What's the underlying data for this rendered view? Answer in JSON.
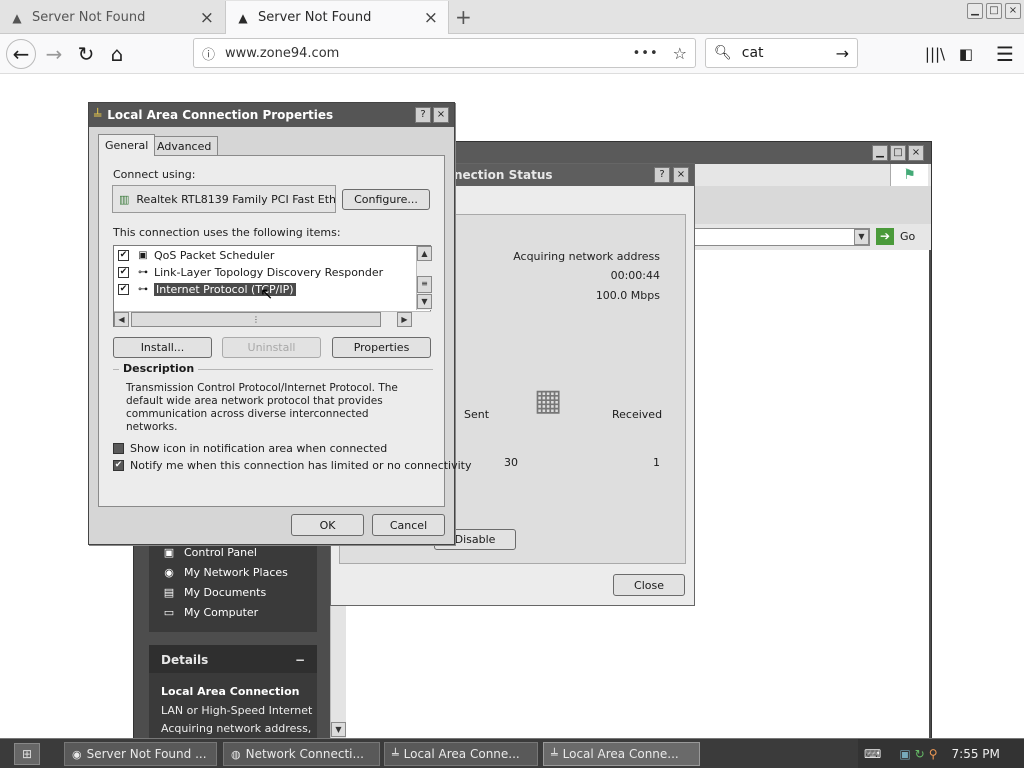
{
  "browser": {
    "tabs": [
      {
        "title": "Server Not Found",
        "icon": "warning-icon",
        "active": false
      },
      {
        "title": "Server Not Found",
        "icon": "warning-icon",
        "active": true
      }
    ],
    "new_tab_glyph": "+",
    "url": "www.zone94.com",
    "search_query": "cat",
    "nav_icons": [
      "back-icon",
      "forward-icon",
      "reload-icon",
      "home-icon"
    ],
    "toolbar_icons": [
      "library-icon",
      "sidebar-icon",
      "menu-icon"
    ]
  },
  "network_connections_window": {
    "go_label": "Go",
    "other_places": [
      {
        "label": "Control Panel",
        "icon": "control-panel-icon"
      },
      {
        "label": "My Network Places",
        "icon": "network-places-icon"
      },
      {
        "label": "My Documents",
        "icon": "documents-icon"
      },
      {
        "label": "My Computer",
        "icon": "computer-icon"
      }
    ],
    "details": {
      "heading": "Details",
      "name": "Local Area Connection",
      "line1": "LAN or High-Speed Internet",
      "line2": "Acquiring network address,"
    }
  },
  "status_dialog": {
    "title": "nection Status",
    "status_value": "Acquiring network address",
    "duration_value": "00:00:44",
    "speed_value": "100.0 Mbps",
    "sent_label": "Sent",
    "received_label": "Received",
    "sent_value": "30",
    "received_value": "1",
    "disable_label": "Disable",
    "close_label": "Close"
  },
  "properties_dialog": {
    "title": "Local Area Connection Properties",
    "tabs": [
      "General",
      "Advanced"
    ],
    "connect_using_label": "Connect using:",
    "adapter_name": "Realtek RTL8139 Family PCI Fast Eth",
    "configure_label": "Configure...",
    "items_label": "This connection uses the following items:",
    "items": [
      {
        "label": "QoS Packet Scheduler",
        "checked": true,
        "selected": false,
        "icon": "scheduler-icon"
      },
      {
        "label": "Link-Layer Topology Discovery Responder",
        "checked": true,
        "selected": false,
        "icon": "protocol-icon"
      },
      {
        "label": "Internet Protocol (TCP/IP)",
        "checked": true,
        "selected": true,
        "icon": "protocol-icon"
      }
    ],
    "install_label": "Install...",
    "uninstall_label": "Uninstall",
    "properties_label": "Properties",
    "description_heading": "Description",
    "description_text": "Transmission Control Protocol/Internet Protocol. The default wide area network protocol that provides communication across diverse interconnected networks.",
    "show_icon_label": "Show icon in notification area when connected",
    "show_icon_checked": false,
    "notify_label": "Notify me when this connection has limited or no connectivity",
    "notify_checked": true,
    "ok_label": "OK",
    "cancel_label": "Cancel"
  },
  "taskbar": {
    "items": [
      {
        "label": "Server Not Found ...",
        "icon": "firefox-icon",
        "active": false
      },
      {
        "label": "Network Connecti...",
        "icon": "network-icon",
        "active": false
      },
      {
        "label": "Local Area Conne...",
        "icon": "connection-icon",
        "active": false
      },
      {
        "label": "Local Area Conne...",
        "icon": "connection-icon",
        "active": true
      }
    ],
    "clock": "7:55 PM"
  }
}
